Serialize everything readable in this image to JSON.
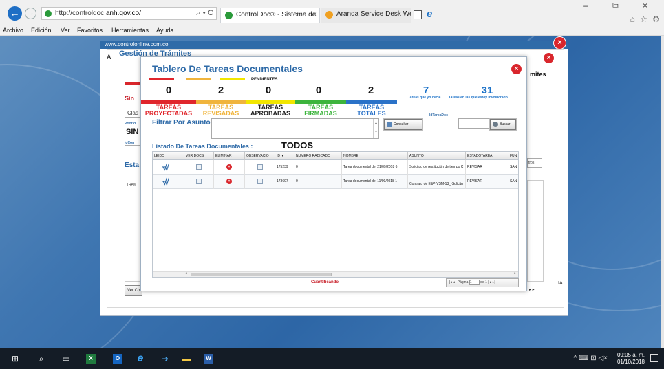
{
  "browser": {
    "url_prefix": "http://controldoc.",
    "url_domain": "anh.gov.co/",
    "address_tools": "⌕ ▾ C",
    "tabs": [
      {
        "label": "ControlDoc® - Sistema de ...",
        "close": "×",
        "favicon_color": "#2a9a3a"
      },
      {
        "label": "Aranda Service Desk Web Editi...",
        "favicon_color": "#f0a020"
      }
    ],
    "window_buttons": "–  ⧉  ×",
    "fav_icons": "⌂ ☆ ⚙",
    "menu": [
      "Archivo",
      "Edición",
      "Ver",
      "Favoritos",
      "Herramientas",
      "Ayuda"
    ]
  },
  "outer": {
    "title_strip": "www.controlonline.com.co",
    "heading": "Gestión de Trámites",
    "right_heading": "mites",
    "frag_sin": "Sin",
    "frag_clas": "Clas",
    "frag_priorid": "Priorid",
    "frag_sin2": "SIN",
    "frag_idcon": "IdCon",
    "frag_esta": "Esta",
    "frag_tram": "TRAM",
    "frag_a": "A",
    "frag_ia": "IA",
    "btn_ver": "Ver Co",
    "btn_tros": "tros",
    "pager_frag": "▸ ▸|"
  },
  "dialog": {
    "title": "Tablero De Tareas Documentales",
    "pendientes_label": "PENDIENTES",
    "counts": {
      "proyectadas": "0",
      "revisadas": "2",
      "aprobadas": "0",
      "firmadas": "0",
      "totales": "2"
    },
    "categories": {
      "proyectadas": [
        "TAREAS",
        "PROYECTADAS"
      ],
      "revisadas": [
        "TAREAS",
        "REVISADAS"
      ],
      "aprobadas": [
        "TAREAS",
        "APROBADAS"
      ],
      "firmadas": [
        "TAREAS",
        "FIRMADAS"
      ],
      "totales": [
        "TAREAS",
        "TOTALES"
      ]
    },
    "iniciadas": {
      "count": "7",
      "caption": "Tareas que yo inicié"
    },
    "involucrado": {
      "count": "31",
      "caption": "Tareas en las que estoy involucrado"
    },
    "filter_label": "Filtrar Por Asunto :",
    "filter_value": "",
    "consultar_button": "Consultar",
    "idtarea_label": "IdTareaDoc",
    "idtarea_value": "",
    "buscar_button": "Buscar",
    "list_label": "Listado De Tareas Documentales :",
    "scope": "TODOS",
    "columns": [
      "LEIDO",
      "VER DOCS",
      "ELIMINAR",
      "OBSERVACIO",
      "ID ▼",
      "NUMERO RADICADO",
      "NOMBRE",
      "ASUNTO",
      "ESTADOTAREA",
      "FUN"
    ],
    "rows": [
      {
        "id": "175239",
        "radicado": "0",
        "nombre": "Tarea documental del 21/09/2018 6",
        "asunto": "Solicitud de restitución de tiempo C",
        "estado": "REVISAR",
        "fun": "SAN"
      },
      {
        "id": "173697",
        "radicado": "0",
        "nombre": "Tarea documental del 11/09/2018 1",
        "asunto": "Contrato de E&P-VSM-13_-Solicitu",
        "estado": "REVISAR",
        "fun": "SAN"
      }
    ],
    "cuantificando": "Cuantificando",
    "pager": {
      "nav_prev": "|◂ ◂ |",
      "page_label": "Página",
      "page_value": "1",
      "of_label": "de 1",
      "nav_next": "| ▸ ▸|"
    }
  },
  "colors": {
    "proyectadas": "#e0262c",
    "revisadas": "#f0b43c",
    "aprobadas": "#f2e600",
    "firmadas": "#3cb43c",
    "totales": "#2a72c8",
    "accent": "#2f6ba8"
  },
  "taskbar": {
    "start": "⊞",
    "search": "⌕",
    "taskview": "▭",
    "excel": "X",
    "outlook": "O",
    "ie": "e",
    "arrow": "➜",
    "explorer": "▬",
    "word": "W",
    "tray": "^ ⌨ ⊡ ◁×",
    "time": "09:05 a. m.",
    "date": "01/10/2018"
  }
}
